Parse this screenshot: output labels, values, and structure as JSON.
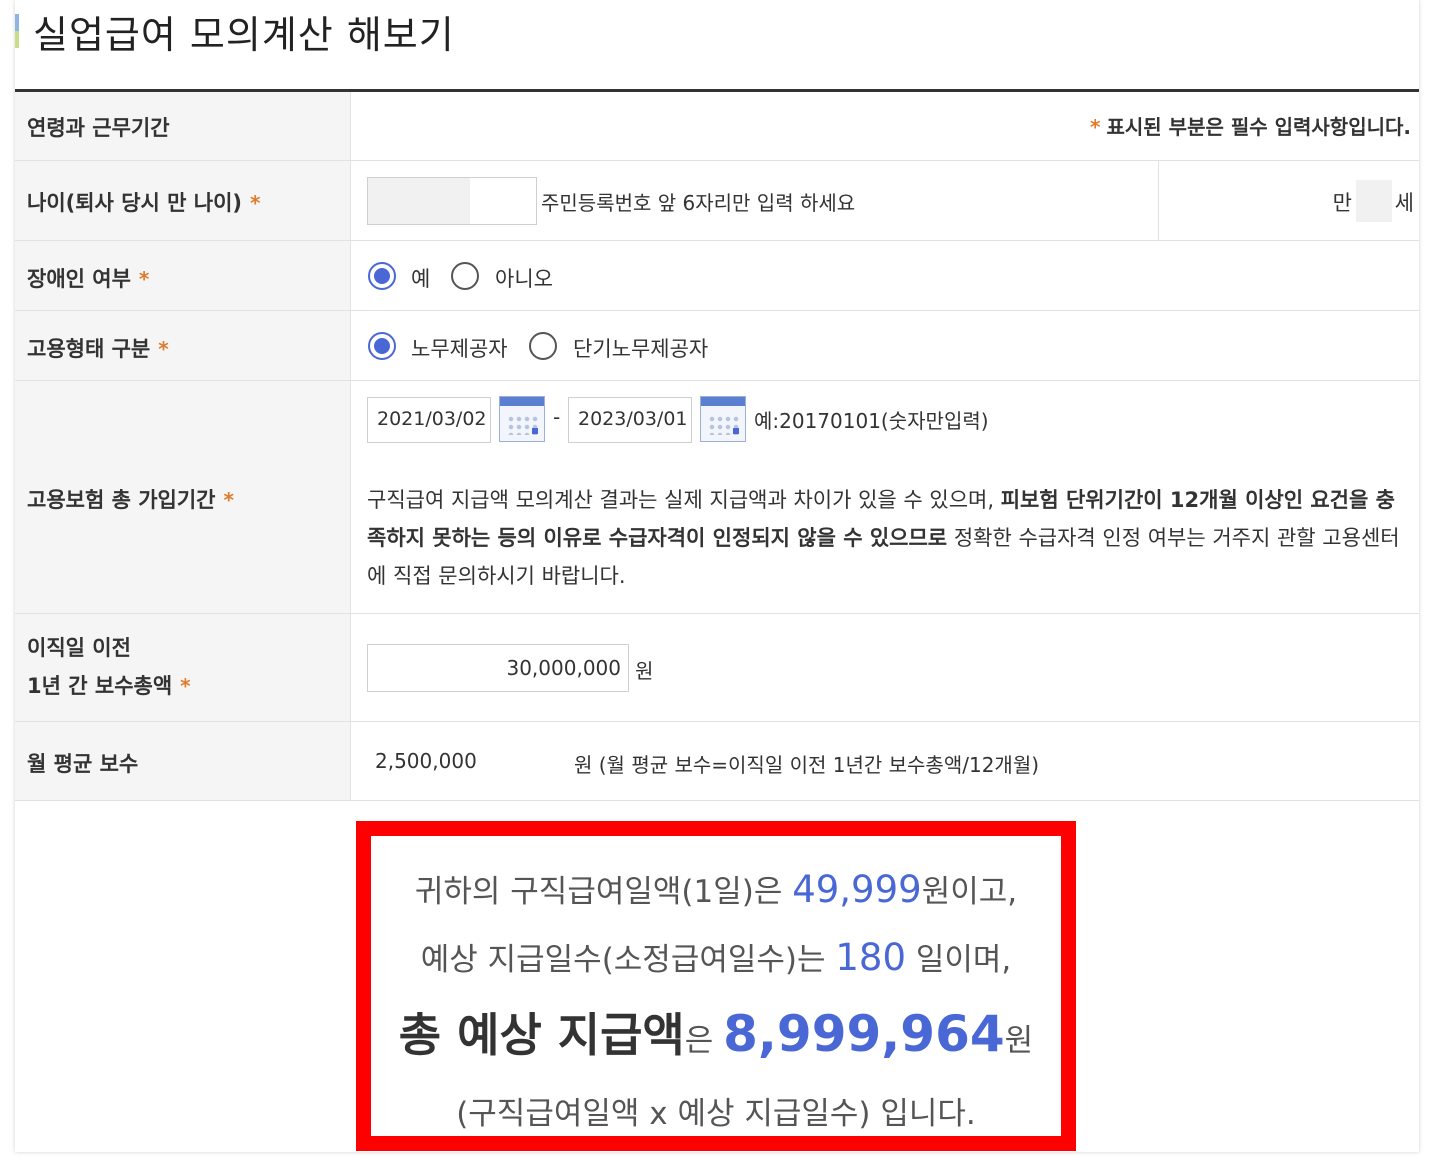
{
  "page": {
    "title": "실업급여 모의계산 해보기"
  },
  "header_row": {
    "label": "연령과 근무기간",
    "required_star": "*",
    "required_note": "표시된 부분은 필수 입력사항입니다."
  },
  "age_row": {
    "label": "나이(퇴사 당시 만 나이)",
    "star": "*",
    "input_value": "",
    "hint": "주민등록번호 앞 6자리만 입력 하세요",
    "man_label": "만",
    "age_value": "",
    "se_label": "세"
  },
  "disability_row": {
    "label": "장애인 여부",
    "star": "*",
    "options": [
      {
        "label": "예",
        "selected": true
      },
      {
        "label": "아니오",
        "selected": false
      }
    ]
  },
  "employment_row": {
    "label": "고용형태 구분",
    "star": "*",
    "options": [
      {
        "label": "노무제공자",
        "selected": true
      },
      {
        "label": "단기노무제공자",
        "selected": false
      }
    ]
  },
  "insurance_row": {
    "label": "고용보험 총 가입기간",
    "star": "*",
    "start_date": "2021/03/02",
    "dash": "-",
    "end_date": "2023/03/01",
    "date_hint": "예:20170101(숫자만입력)",
    "notice_part1": "구직급여 지급액 모의계산 결과는 실제 지급액과 차이가 있을 수 있으며, ",
    "notice_bold": "피보험 단위기간이 12개월 이상인 요건을 충족하지 못하는 등의 이유로 수급자격이 인정되지 않을 수 있으므로",
    "notice_part2": " 정확한 수급자격 인정 여부는 거주지 관할 고용센터에 직접 문의하시기 바랍니다."
  },
  "salary_row": {
    "label_line1": "이직일 이전",
    "label_line2": "1년 간 보수총액",
    "star": "*",
    "value": "30,000,000",
    "unit": "원"
  },
  "monthly_row": {
    "label": "월 평균 보수",
    "value": "2,500,000",
    "note": "원 (월 평균 보수=이직일 이전 1년간 보수총액/12개월)"
  },
  "result": {
    "line1_pre": "귀하의 구직급여일액(1일)은 ",
    "daily_amount": "49,999",
    "line1_post": "원이고,",
    "line2_pre": "예상 지급일수(소정급여일수)는 ",
    "days": "180",
    "line2_post": " 일이며,",
    "line3_bold": "총 예상 지급액",
    "line3_mid": "은 ",
    "total_amount": "8,999,964",
    "line3_post": "원",
    "line4": "(구직급여일액 x 예상 지급일수) 입니다."
  },
  "colors": {
    "accent_blue": "#4a67d6",
    "required_star": "#e07b2a",
    "highlight_border": "#ff0000"
  }
}
